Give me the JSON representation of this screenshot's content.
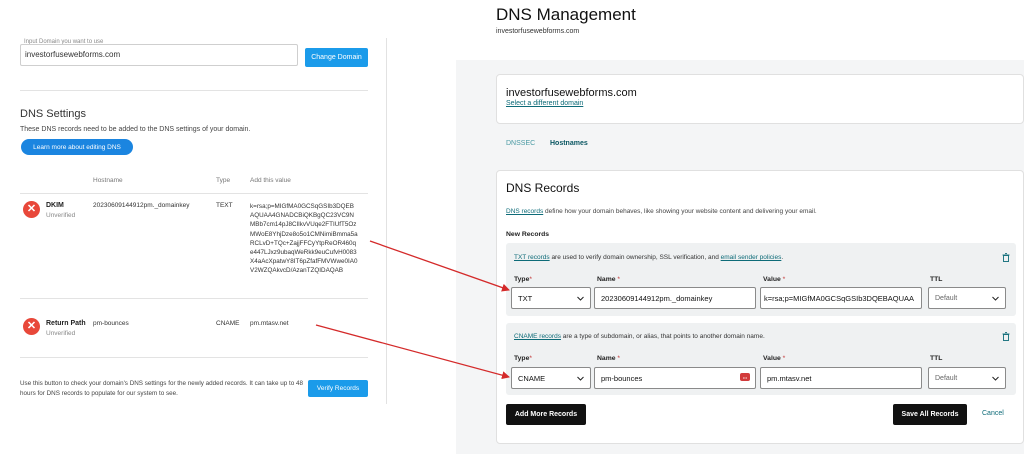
{
  "left": {
    "input_label": "Input Domain you want to use",
    "domain_value": "investorfusewebforms.com",
    "change_domain_label": "Change Domain",
    "dns_settings_title": "DNS Settings",
    "dns_settings_desc": "These DNS records need to be added to the DNS settings of your domain.",
    "learn_more_label": "Learn more about editing DNS",
    "columns": [
      "Hostname",
      "Type",
      "Add this value"
    ],
    "records": [
      {
        "name": "DKIM",
        "status": "Unverified",
        "hostname": "20230609144912pm._domainkey",
        "type": "TEXT",
        "value_lines": [
          "k=rsa;p=MIGfMA0GCSqGSIb3DQEB",
          "AQUAA4GNADCBiQKBgQC23VC9N",
          "MBb7cm14pJ8CIlkvVUqe2FTIUfT5Oz",
          "MWoE8YhjDze8o5o1CMNimiBmma5a",
          "RCLvD+TQc+ZajjFFCyYtpReOR460q",
          "e447LJxz9ubaqWeRkk9euCufvH0083",
          "X4aAcXpatwY8IT6pZfafFMVWwe0IA0",
          "V2WZQAkvcD/AzanTZQIDAQAB"
        ]
      },
      {
        "name": "Return Path",
        "status": "Unverified",
        "hostname": "pm-bounces",
        "type": "CNAME",
        "value": "pm.mtasv.net"
      }
    ],
    "verify_text": "Use this button to check your domain's DNS settings for the newly added records. It can take up to 48 hours for DNS records to populate for our system to see.",
    "verify_label": "Verify Records"
  },
  "right": {
    "title": "DNS Management",
    "subtitle": "investorfusewebforms.com",
    "domain": "investorfusewebforms.com",
    "select_domain_link": "Select a different domain",
    "tabs": [
      {
        "label": "DNSSEC",
        "active": false
      },
      {
        "label": "Hostnames",
        "active": true
      }
    ],
    "records_title": "DNS Records",
    "records_desc_link": "DNS records",
    "records_desc_rest": " define how your domain behaves, like showing your website content and delivering your email.",
    "new_records_label": "New Records",
    "txt_section": {
      "link": "TXT records",
      "text_mid": " are used to verify domain ownership, SSL verification, and ",
      "link2": "email sender policies",
      "text_end": ".",
      "type_label": "Type",
      "name_label": "Name",
      "value_label": "Value",
      "ttl_label": "TTL",
      "type_value": "TXT",
      "name_value": "20230609144912pm._domainkey",
      "value_value": "k=rsa;p=MIGfMA0GCSqGSIb3DQEBAQUAA",
      "ttl_value": "Default"
    },
    "cname_section": {
      "link": "CNAME records",
      "text_rest": " are a type of subdomain, or alias, that points to another domain name.",
      "type_label": "Type",
      "name_label": "Name",
      "value_label": "Value",
      "ttl_label": "TTL",
      "type_value": "CNAME",
      "name_value": "pm-bounces",
      "value_value": "pm.mtasv.net",
      "ttl_value": "Default"
    },
    "add_more_label": "Add More Records",
    "save_all_label": "Save All Records",
    "cancel_label": "Cancel"
  },
  "colors": {
    "primary_blue": "#1b9bea",
    "error_red": "#e8483a",
    "teal_link": "#0d6b78",
    "arrow_red": "#d42a2a"
  }
}
